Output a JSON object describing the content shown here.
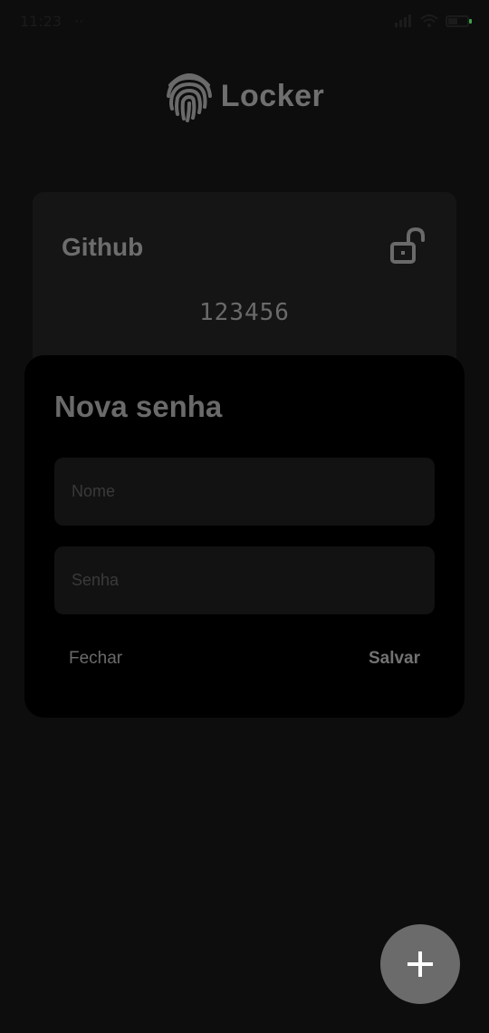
{
  "status_bar": {
    "time": "11:23",
    "extra_indicator": "··",
    "battery_accent": "#3da24a"
  },
  "header": {
    "app_title": "Locker",
    "logo_icon": "fingerprint-icon"
  },
  "password_card": {
    "name": "Github",
    "password": "123456",
    "lock_icon": "unlocked-padlock-icon"
  },
  "dialog": {
    "title": "Nova senha",
    "name_field": {
      "placeholder": "Nome",
      "value": ""
    },
    "password_field": {
      "placeholder": "Senha",
      "value": ""
    },
    "close_label": "Fechar",
    "save_label": "Salvar"
  },
  "fab": {
    "icon": "plus-icon"
  },
  "colors": {
    "background": "#0d0d0d",
    "card": "#151515",
    "dialog": "#000000",
    "fab": "#6b6b6b",
    "text_muted": "#6a6a6a"
  }
}
